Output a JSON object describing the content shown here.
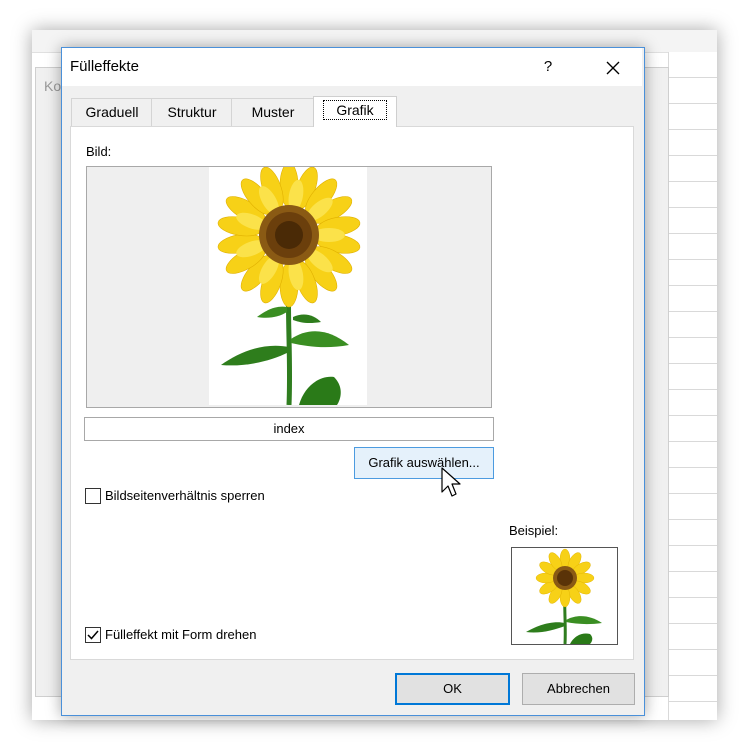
{
  "background": {
    "dialog_label": "Ko"
  },
  "dialog": {
    "title": "Fülleffekte",
    "help_label": "?",
    "tabs": [
      "Graduell",
      "Struktur",
      "Muster",
      "Grafik"
    ],
    "active_tab": "Grafik",
    "picture_label": "Bild:",
    "picture_name": "index",
    "select_picture_button": "Grafik auswählen...",
    "lock_aspect_label": "Bildseitenverhältnis sperren",
    "lock_aspect_checked": false,
    "rotate_with_shape_label": "Fülleffekt mit Form drehen",
    "rotate_with_shape_checked": true,
    "preview_label": "Beispiel:",
    "ok_button": "OK",
    "cancel_button": "Abbrechen"
  },
  "colors": {
    "accent": "#0078d7",
    "selected_button_bg": "#e5f1fb",
    "dialog_bg": "#f0f0f0"
  },
  "icons": [
    "close-icon",
    "check-icon",
    "mouse-pointer-icon",
    "sunflower-image"
  ]
}
